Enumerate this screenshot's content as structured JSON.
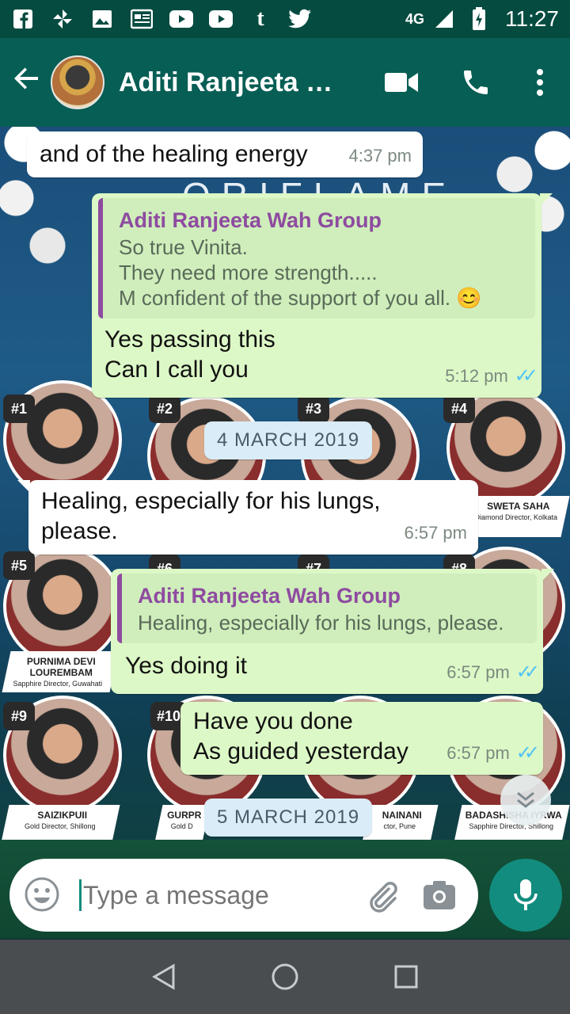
{
  "status_bar": {
    "network": "4G",
    "time": "11:27",
    "notification_icons": [
      "facebook-icon",
      "pinwheel-icon",
      "gallery-icon",
      "news-icon",
      "youtube-icon",
      "youtube-icon",
      "tumblr-icon",
      "twitter-icon"
    ]
  },
  "header": {
    "title": "Aditi Ranjeeta W...",
    "icons": [
      "back-arrow-icon",
      "video-call-icon",
      "phone-call-icon",
      "more-vert-icon"
    ]
  },
  "wallpaper": {
    "brand": "ORIFLAME",
    "rank_badges": [
      "#1",
      "#2",
      "#3",
      "#4",
      "#5",
      "#6",
      "#7",
      "#8",
      "#9",
      "#10"
    ],
    "plates": [
      {
        "name": "SWETA SAHA",
        "title": "Diamond Director, Kolkata"
      },
      {
        "name": "PURNIMA DEVI LOUREMBAM",
        "title": "Sapphire Director, Guwahati"
      },
      {
        "name": "SAIZIKPUII",
        "title": "Gold Director, Shillong"
      },
      {
        "name": "GURPR",
        "title": "Gold D"
      },
      {
        "name": "NAINANI",
        "title": "ctor, Pune"
      },
      {
        "name": "BADASHISHA IYRWA",
        "title": "Sapphire Director, Shillong"
      }
    ]
  },
  "messages": [
    {
      "type": "in",
      "text": "and of the healing energy",
      "time": "4:37 pm"
    },
    {
      "type": "out",
      "quote_name": "Aditi Ranjeeta Wah Group",
      "quote_lines": [
        "So true Vinita.",
        "They need more strength.....",
        "M confident of the support of you all. 😊"
      ],
      "lines": [
        "Yes passing this",
        "Can I call you"
      ],
      "time": "5:12 pm",
      "status": "read"
    },
    {
      "type": "date",
      "text": "4 MARCH 2019"
    },
    {
      "type": "in",
      "lines": [
        "Healing, especially for his lungs,",
        "please."
      ],
      "time": "6:57 pm"
    },
    {
      "type": "out",
      "quote_name": "Aditi Ranjeeta Wah Group",
      "quote_lines": [
        "Healing, especially for his lungs, please."
      ],
      "lines": [
        "Yes doing it"
      ],
      "time": "6:57 pm",
      "status": "read"
    },
    {
      "type": "out",
      "lines": [
        "Have you done",
        "As guided yesterday"
      ],
      "time": "6:57 pm",
      "status": "read"
    },
    {
      "type": "date",
      "text": "5 MARCH 2019"
    }
  ],
  "composer": {
    "placeholder": "Type a message",
    "icons": [
      "emoji-icon",
      "attach-icon",
      "camera-icon",
      "mic-icon"
    ]
  },
  "colors": {
    "primary": "#075e54",
    "accent": "#128c7e",
    "outgoing": "#dcf8c6",
    "incoming": "#ffffff",
    "quote_name": "#8e4ba0",
    "read_ticks": "#4fc3f7"
  }
}
